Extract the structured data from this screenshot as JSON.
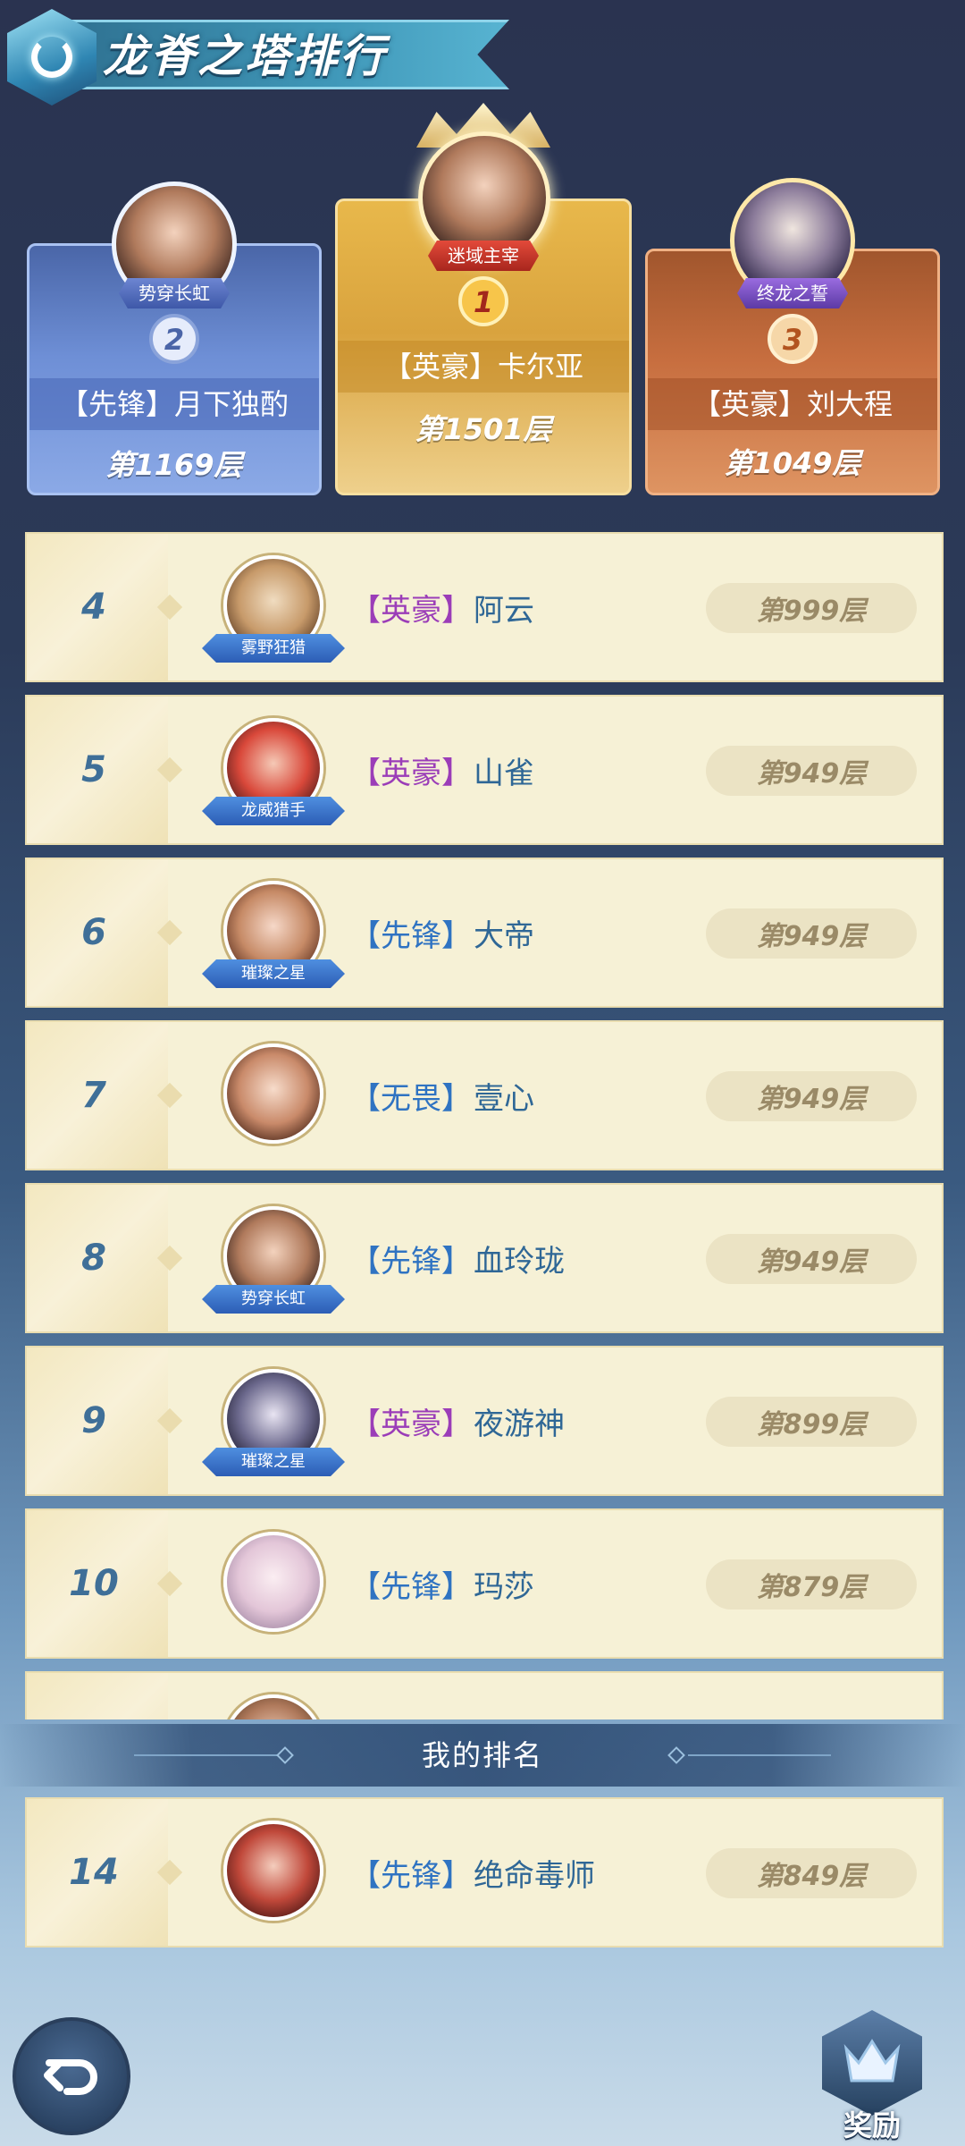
{
  "header": {
    "title": "龙脊之塔排行"
  },
  "podium": [
    {
      "rank": "2",
      "badge": "势穿长虹",
      "tag": "【先锋】",
      "name": "月下独酌",
      "floor": "第1169层"
    },
    {
      "rank": "1",
      "badge": "迷域主宰",
      "tag": "【英豪】",
      "name": "卡尔亚",
      "floor": "第1501层"
    },
    {
      "rank": "3",
      "badge": "终龙之誓",
      "tag": "【英豪】",
      "name": "刘大程",
      "floor": "第1049层"
    }
  ],
  "list": [
    {
      "rank": "4",
      "frame": "雾野狂猎",
      "tag": "【英豪】",
      "name": "阿云",
      "floor": "第999层"
    },
    {
      "rank": "5",
      "frame": "龙威猎手",
      "tag": "【英豪】",
      "name": "山雀",
      "floor": "第949层"
    },
    {
      "rank": "6",
      "frame": "璀璨之星",
      "tag": "【先锋】",
      "name": "大帝",
      "floor": "第949层"
    },
    {
      "rank": "7",
      "frame": "",
      "tag": "【无畏】",
      "name": "壹心",
      "floor": "第949层"
    },
    {
      "rank": "8",
      "frame": "势穿长虹",
      "tag": "【先锋】",
      "name": "血玲珑",
      "floor": "第949层"
    },
    {
      "rank": "9",
      "frame": "璀璨之星",
      "tag": "【英豪】",
      "name": "夜游神",
      "floor": "第899层"
    },
    {
      "rank": "10",
      "frame": "",
      "tag": "【先锋】",
      "name": "玛莎",
      "floor": "第879层"
    }
  ],
  "my_rank": {
    "section_label": "我的排名",
    "rank": "14",
    "tag": "【先锋】",
    "name": "绝命毒师",
    "floor": "第849层"
  },
  "buttons": {
    "back_icon": "back-arrow-icon",
    "reward_label": "奖励",
    "reward_icon": "crown-trophy-icon"
  },
  "colors": {
    "accent": "#3f6f98",
    "hero_tag": "#9b3db8",
    "vanguard_tag": "#2f73c2",
    "row_bg": "#f6f1d6"
  }
}
